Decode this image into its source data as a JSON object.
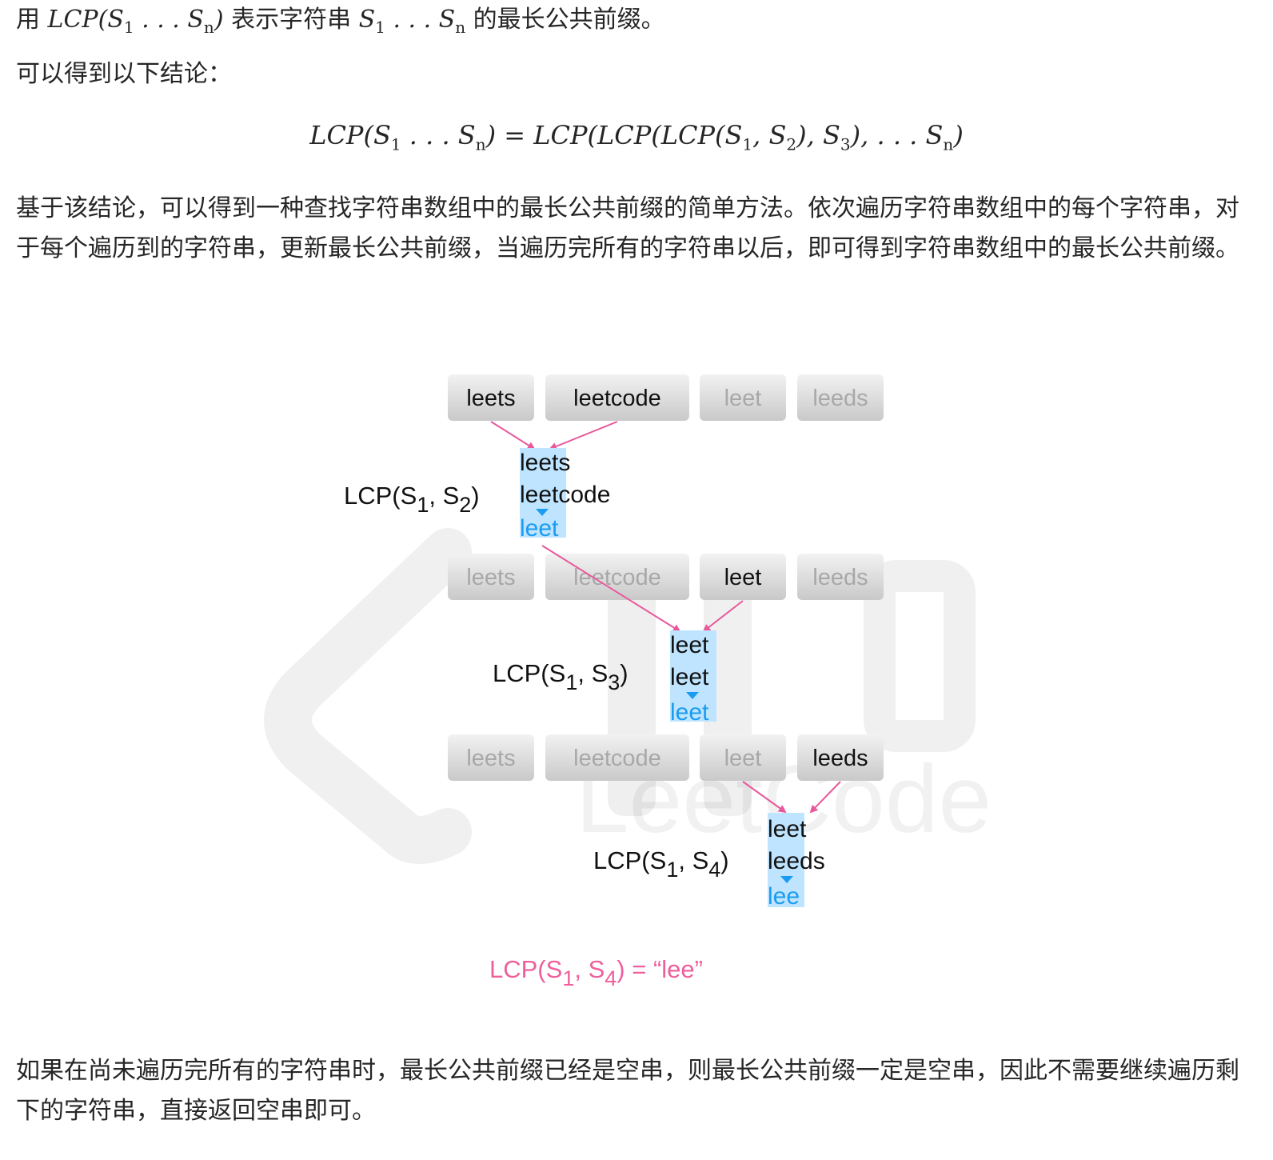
{
  "intro": {
    "prefix": "用 ",
    "math_lcp": "LCP(S",
    "sub1": "1",
    "dots": " . . . S",
    "subn": "n",
    "close": ")",
    "mid": " 表示字符串 ",
    "s": "S",
    "dots2": " . . . S",
    "suffix": " 的最长公共前缀。"
  },
  "conclusion_label": "可以得到以下结论：",
  "formula": {
    "lhs": "LCP(S",
    "rhs": "LCP(LCP(LCP(S"
  },
  "paragraph1": "基于该结论，可以得到一种查找字符串数组中的最长公共前缀的简单方法。依次遍历字符串数组中的每个字符串，对于每个遍历到的字符串，更新最长公共前缀，当遍历完所有的字符串以后，即可得到字符串数组中的最长公共前缀。",
  "paragraph2": "如果在尚未遍历完所有的字符串时，最长公共前缀已经是空串，则最长公共前缀一定是空串，因此不需要继续遍历剩下的字符串，直接返回空串即可。",
  "figure": {
    "strings": [
      "leets",
      "leetcode",
      "leet",
      "leeds"
    ],
    "steps": [
      {
        "label": "LCP(S",
        "sub_a": "1",
        "sub_b": "2",
        "pair": [
          "leets",
          "leetcode"
        ],
        "common": "leet",
        "result": "leet"
      },
      {
        "label": "LCP(S",
        "sub_a": "1",
        "sub_b": "3",
        "pair": [
          "leet",
          "leet"
        ],
        "common": "leet",
        "result": "leet"
      },
      {
        "label": "LCP(S",
        "sub_a": "1",
        "sub_b": "4",
        "pair": [
          "leet",
          "leeds"
        ],
        "common": "lee",
        "result": "lee"
      }
    ],
    "final": {
      "label": "LCP(S",
      "sub_a": "1",
      "sub_b": "4",
      "value": " = “lee”"
    },
    "watermark": "LeetCode",
    "colors": {
      "highlight": "#bfe4ff",
      "result": "#1a9cf2",
      "arrow": "#e8589a",
      "final": "#ee5f9b",
      "box_active_text": "#111111",
      "box_dim_text": "#a8a8a8"
    }
  }
}
